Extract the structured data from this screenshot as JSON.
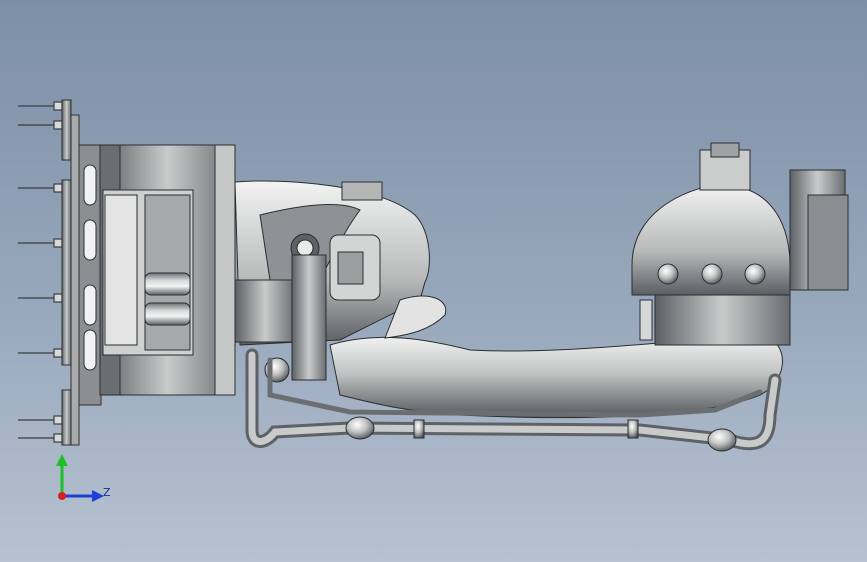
{
  "viewport": {
    "background_top": "#7d8fa6",
    "background_bottom": "#b6c2d1"
  },
  "model": {
    "description_icon": "robot-arm-model",
    "shade_dark": "#4a4d52",
    "shade_mid": "#9a9c9e",
    "shade_light": "#e4e6e6"
  },
  "triad": {
    "z_label": "Z",
    "x_axis_color": "#d42020",
    "y_axis_color": "#1fbf2b",
    "z_axis_color": "#1f3fd6"
  }
}
